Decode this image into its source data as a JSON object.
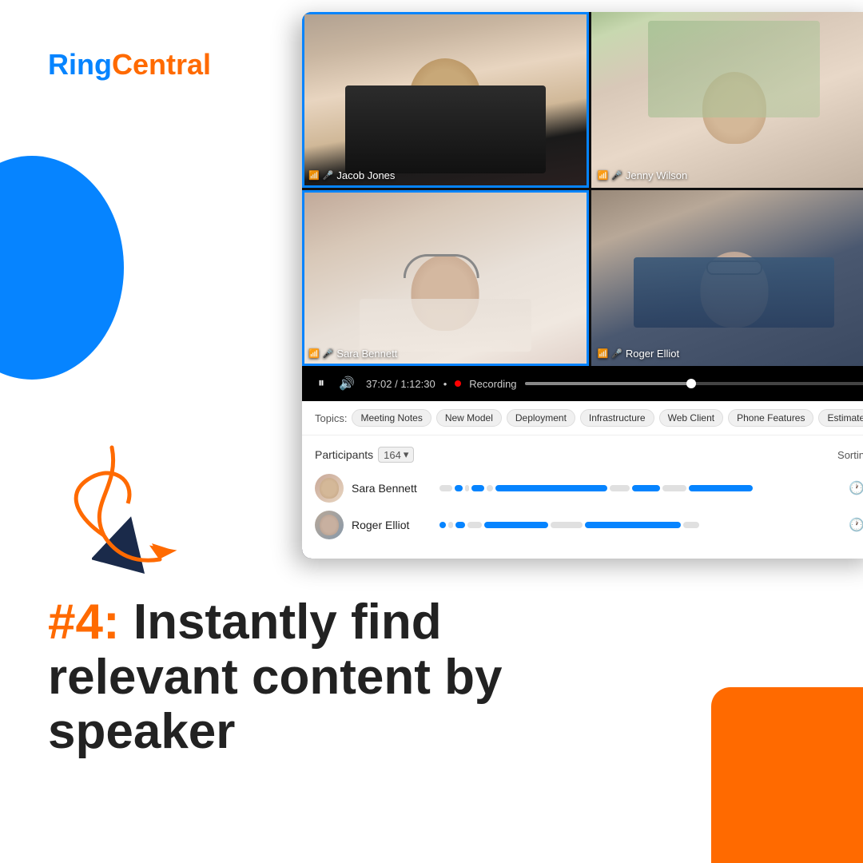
{
  "logo": {
    "ring": "Ring",
    "central": "Central"
  },
  "video_call": {
    "participants": [
      {
        "name": "Jacob Jones",
        "position": "top-left",
        "active_speaker": true
      },
      {
        "name": "Jenny Wilson",
        "position": "top-right",
        "active_speaker": false
      },
      {
        "name": "Sara Bennett",
        "position": "bottom-left",
        "active_speaker": false
      },
      {
        "name": "Roger Elliot",
        "position": "bottom-right",
        "active_speaker": false
      }
    ],
    "time_current": "37:02",
    "time_total": "1:12:30",
    "recording_label": "Recording",
    "topics_label": "Topics:",
    "topics": [
      "Meeting Notes",
      "New Model",
      "Deployment",
      "Infrastructure",
      "Web Client",
      "Phone Features",
      "Estimates"
    ]
  },
  "participants_panel": {
    "title": "Participants",
    "count": "164",
    "sorting_label": "Sortin",
    "rows": [
      {
        "name": "Sara Bennett"
      },
      {
        "name": "Roger Elliot"
      }
    ]
  },
  "cta": {
    "number": "#4:",
    "text": "Instantly find relevant content by speaker"
  },
  "controls": {
    "pause_icon": "⏸",
    "volume_icon": "🔊"
  }
}
